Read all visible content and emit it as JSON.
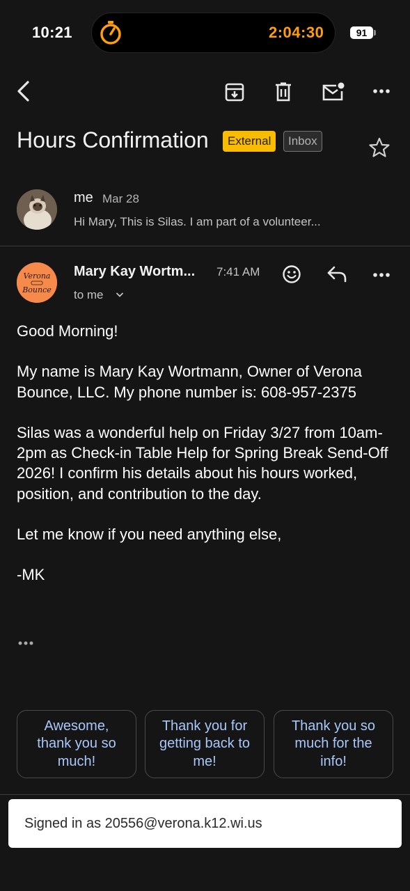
{
  "status_bar": {
    "time": "10:21",
    "timer": "2:04:30",
    "battery": "91",
    "timer_color": "#ff9f0a"
  },
  "toolbar": {
    "back_icon": "arrow-back-icon",
    "archive_icon": "archive-icon",
    "delete_icon": "trash-icon",
    "mark_unread_icon": "mark-unread-icon",
    "more_icon": "more-horizontal-icon"
  },
  "email": {
    "subject": "Hours Confirmation",
    "labels": {
      "external": "External",
      "inbox": "Inbox"
    },
    "external_color": "#f9bc00"
  },
  "thread": {
    "previous": {
      "sender": "me",
      "date": "Mar 28",
      "snippet": "Hi Mary, This is Silas. I am part of a volunteer..."
    },
    "current": {
      "sender": "Mary Kay Wortm...",
      "time": "7:41 AM",
      "recipient": "to me",
      "avatar_text": [
        "Verona",
        "Bounce"
      ],
      "body": "Good Morning!\n\nMy name is Mary Kay Wortmann, Owner of Verona Bounce, LLC. My phone number is: 608-957-2375\n\nSilas was a wonderful help on Friday 3/27 from 10am-2pm as Check-in Table Help for Spring Break Send-Off 2026! I confirm his details about his hours worked, position, and contribution to the day.\n\nLet me know if you need anything else,\n\n-MK"
    }
  },
  "smart_replies": [
    "Awesome, thank you so much!",
    "Thank you for getting back to me!",
    "Thank you so much for the info!"
  ],
  "account_banner": {
    "text": "Signed in as 20556@verona.k12.wi.us"
  },
  "colors": {
    "background": "#151515",
    "link_blue": "#a8c7fa",
    "avatar_orange": "#f58a4a"
  }
}
